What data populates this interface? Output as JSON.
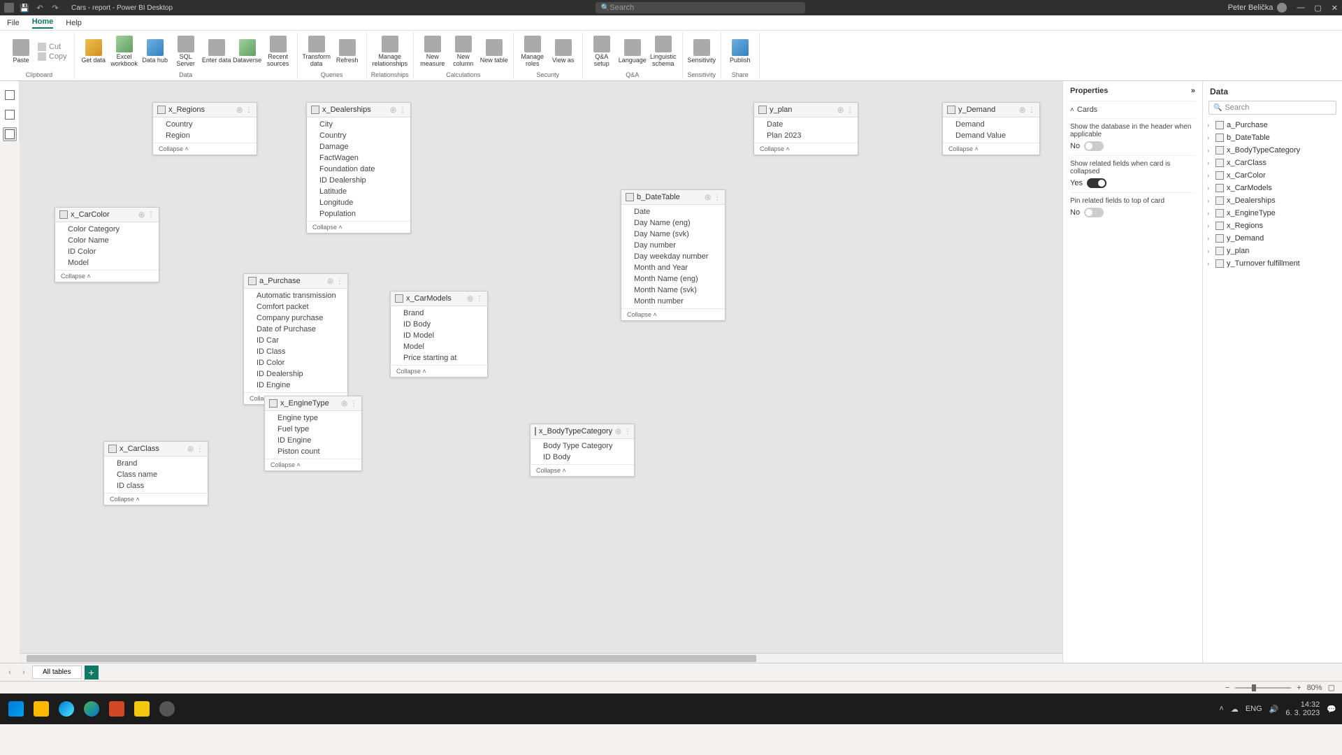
{
  "title": "Cars - report - Power BI Desktop",
  "search_placeholder": "Search",
  "user": "Peter Belička",
  "menus": [
    "File",
    "Home",
    "Help"
  ],
  "ribbon": {
    "clipboard": {
      "paste": "Paste",
      "cut": "Cut",
      "copy": "Copy",
      "label": "Clipboard"
    },
    "data": {
      "get": "Get data",
      "excel": "Excel workbook",
      "hub": "Data hub",
      "sql": "SQL Server",
      "enter": "Enter data",
      "dv": "Dataverse",
      "recent": "Recent sources",
      "label": "Data"
    },
    "queries": {
      "transform": "Transform data",
      "refresh": "Refresh",
      "label": "Queries"
    },
    "rel": {
      "manage": "Manage relationships",
      "label": "Relationships"
    },
    "calc": {
      "measure": "New measure",
      "column": "New column",
      "table": "New table",
      "label": "Calculations"
    },
    "sec": {
      "roles": "Manage roles",
      "view": "View as",
      "label": "Security"
    },
    "qa": {
      "qa": "Q&A setup",
      "lang": "Language",
      "schema": "Linguistic schema",
      "label": "Q&A"
    },
    "sens": {
      "btn": "Sensitivity",
      "label": "Sensitivity"
    },
    "share": {
      "btn": "Publish",
      "label": "Share"
    }
  },
  "tables": {
    "regions": {
      "name": "x_Regions",
      "fields": [
        "Country",
        "Region"
      ]
    },
    "dealerships": {
      "name": "x_Dealerships",
      "fields": [
        "City",
        "Country",
        "Damage",
        "FactWagen",
        "Foundation date",
        "ID Dealership",
        "Latitude",
        "Longitude",
        "Population"
      ]
    },
    "plan": {
      "name": "y_plan",
      "fields": [
        "Date",
        "Plan 2023"
      ]
    },
    "demand": {
      "name": "y_Demand",
      "fields": [
        "Demand",
        "Demand Value"
      ]
    },
    "carcolor": {
      "name": "x_CarColor",
      "fields": [
        "Color Category",
        "Color Name",
        "ID Color",
        "Model"
      ]
    },
    "datetable": {
      "name": "b_DateTable",
      "fields": [
        "Date",
        "Day Name (eng)",
        "Day Name (svk)",
        "Day number",
        "Day weekday number",
        "Month and Year",
        "Month Name (eng)",
        "Month Name (svk)",
        "Month number"
      ]
    },
    "purchase": {
      "name": "a_Purchase",
      "fields": [
        "Automatic transmission",
        "Comfort packet",
        "Company purchase",
        "Date of Purchase",
        "ID Car",
        "ID Class",
        "ID Color",
        "ID Dealership",
        "ID Engine"
      ]
    },
    "carmodels": {
      "name": "x_CarModels",
      "fields": [
        "Brand",
        "ID Body",
        "ID Model",
        "Model",
        "Price starting at"
      ]
    },
    "enginetype": {
      "name": "x_EngineType",
      "fields": [
        "Engine type",
        "Fuel type",
        "ID Engine",
        "Piston count"
      ]
    },
    "body": {
      "name": "x_BodyTypeCategory",
      "fields": [
        "Body Type Category",
        "ID Body"
      ]
    },
    "carclass": {
      "name": "x_CarClass",
      "fields": [
        "Brand",
        "Class name",
        "ID class"
      ]
    }
  },
  "collapse_label": "Collapse",
  "properties": {
    "title": "Properties",
    "cards": "Cards",
    "show_db": "Show the database in the header when applicable",
    "show_db_val": "No",
    "show_related": "Show related fields when card is collapsed",
    "show_related_val": "Yes",
    "pin": "Pin related fields to top of card",
    "pin_val": "No"
  },
  "data_pane": {
    "title": "Data",
    "search": "Search",
    "items": [
      "a_Purchase",
      "b_DateTable",
      "x_BodyTypeCategory",
      "x_CarClass",
      "x_CarColor",
      "x_CarModels",
      "x_Dealerships",
      "x_EngineType",
      "x_Regions",
      "y_Demand",
      "y_plan",
      "y_Turnover fulfillment"
    ]
  },
  "tab": "All tables",
  "zoom": "80%",
  "tray": {
    "time": "14:32",
    "date": "6. 3. 2023"
  }
}
